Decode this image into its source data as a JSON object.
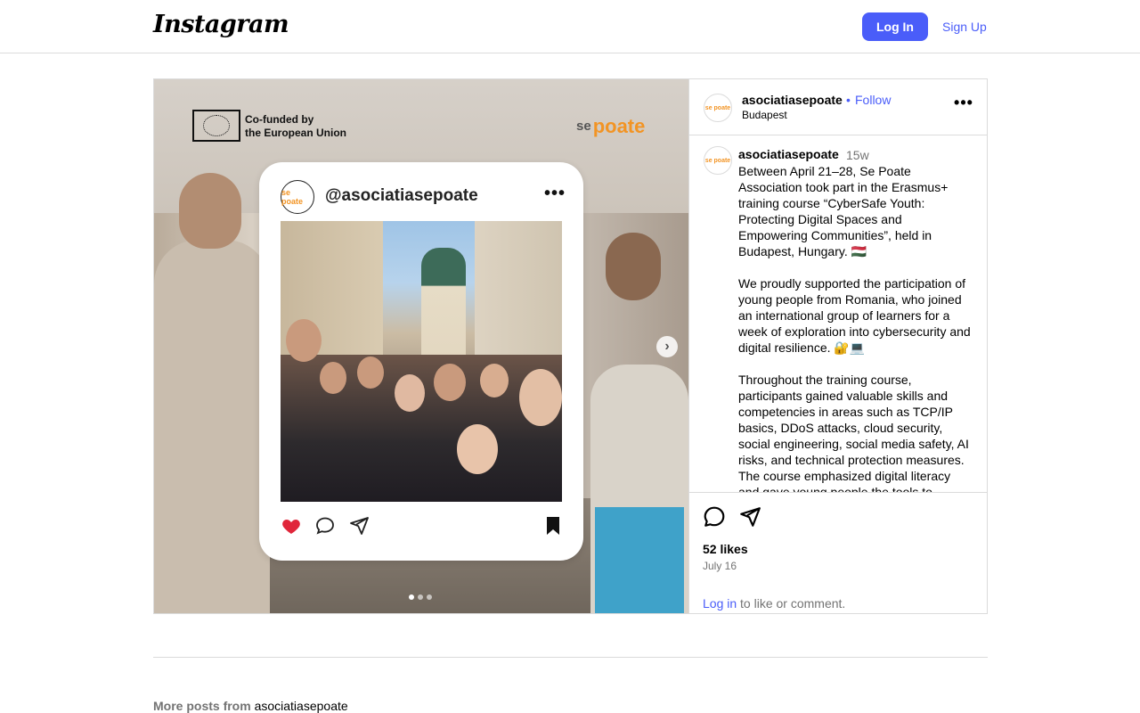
{
  "topbar": {
    "logo": "Instagram",
    "login_label": "Log In",
    "signup_label": "Sign Up"
  },
  "media": {
    "eu_text": "Co-funded by\nthe European Union",
    "brand_se": "se",
    "brand_poate": "poate",
    "card_username": "@asociatiasepoate",
    "card_avatar_text": "se poate",
    "carousel_count": 3,
    "carousel_active_index": 0
  },
  "post": {
    "username": "asociatiasepoate",
    "follow_label": "Follow",
    "separator": "•",
    "location": "Budapest",
    "avatar_text": "se poate",
    "caption_user": "asociatiasepoate",
    "caption_time": "15w",
    "caption": "Between April 21–28, Se Poate Association took part in the Erasmus+ training course “CyberSafe Youth: Protecting Digital Spaces and Empowering Communities”, held in Budapest, Hungary. 🇭🇺\n\nWe proudly supported the participation of young people from Romania, who joined an international group of learners for a week of exploration into cybersecurity and digital resilience. 🔐💻\n\nThroughout the training course, participants gained valuable skills and competencies in areas such as TCP/IP basics, DDoS attacks, cloud security, social engineering, social media safety, AI risks, and technical protection measures. The course emphasized digital literacy and gave young people the tools to",
    "likes": "52 likes",
    "date": "July 16",
    "login_link": "Log in",
    "login_rest": " to like or comment."
  },
  "more_posts": {
    "prefix": "More posts from ",
    "username": "asociatiasepoate"
  },
  "colors": {
    "accent": "#4a5df9",
    "brand_orange": "#f29424",
    "border": "#dbdbdb",
    "muted": "#737373",
    "heart": "#e0263a"
  }
}
